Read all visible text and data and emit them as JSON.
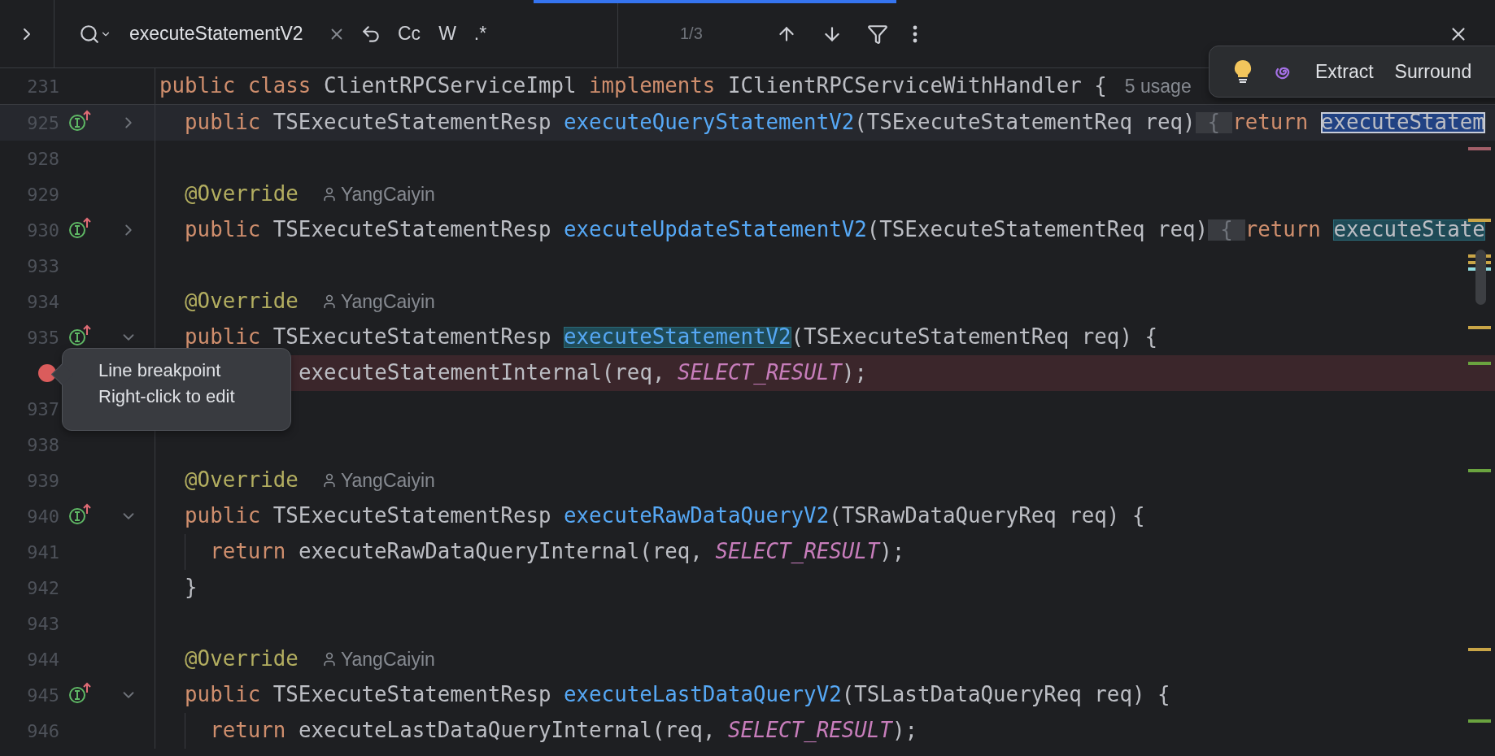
{
  "find_bar": {
    "query": "executeStatementV2",
    "options": [
      {
        "label": "Cc",
        "selected": false
      },
      {
        "label": "W",
        "selected": false
      },
      {
        "label": ".*",
        "selected": false
      }
    ],
    "match_count": "1/3"
  },
  "intention_popup": {
    "actions": [
      "Extract",
      "Surround"
    ]
  },
  "sticky_line": {
    "number": "231",
    "tokens": [
      {
        "kind": "kw",
        "text": "public "
      },
      {
        "kind": "kw",
        "text": "class "
      },
      {
        "kind": "plain",
        "text": "ClientRPCServiceImpl "
      },
      {
        "kind": "kw",
        "text": "implements "
      },
      {
        "kind": "plain",
        "text": "IClientRPCServiceWithHandler {"
      },
      {
        "kind": "usages",
        "text": "5 usage"
      }
    ]
  },
  "lines": [
    {
      "number": "925",
      "kind": "member",
      "impl": true,
      "expanded": false,
      "current": true,
      "tokens": [
        {
          "kind": "kw",
          "text": "public "
        },
        {
          "kind": "plain",
          "text": "TSExecuteStatementResp "
        },
        {
          "kind": "method",
          "text": "executeQueryStatementV2"
        },
        {
          "kind": "plain",
          "text": "(TSExecuteStatementReq req)"
        },
        {
          "kind": "brace",
          "text": "{"
        },
        {
          "kind": "kw",
          "text": "return "
        },
        {
          "kind": "match",
          "method": false,
          "selected": true,
          "text": "executeStatem"
        }
      ]
    },
    {
      "number": "928",
      "marks": [
        {
          "color": "#a35f69"
        }
      ]
    },
    {
      "number": "929",
      "kind": "member",
      "tokens": [
        {
          "kind": "annotation",
          "text": "@Override"
        },
        {
          "kind": "author",
          "text": "YangCaiyin"
        }
      ]
    },
    {
      "number": "930",
      "kind": "member",
      "impl": true,
      "expanded": false,
      "marks": [
        {
          "color": "#c9a547"
        }
      ],
      "tokens": [
        {
          "kind": "kw",
          "text": "public "
        },
        {
          "kind": "plain",
          "text": "TSExecuteStatementResp "
        },
        {
          "kind": "method",
          "text": "executeUpdateStatementV2"
        },
        {
          "kind": "plain",
          "text": "(TSExecuteStatementReq req)"
        },
        {
          "kind": "brace",
          "text": "{"
        },
        {
          "kind": "kw",
          "text": "return "
        },
        {
          "kind": "match",
          "method": false,
          "selected": false,
          "text": "executeState"
        }
      ]
    },
    {
      "number": "933",
      "marks": [
        {
          "color": "#c9a547"
        },
        {
          "color": "#c9a547"
        },
        {
          "color": "#8fd9dc"
        }
      ]
    },
    {
      "number": "934",
      "kind": "member",
      "tokens": [
        {
          "kind": "annotation",
          "text": "@Override"
        },
        {
          "kind": "author",
          "text": "YangCaiyin"
        }
      ]
    },
    {
      "number": "935",
      "kind": "member",
      "impl": true,
      "expanded": true,
      "marks": [
        {
          "color": "#c9a547"
        }
      ],
      "tokens": [
        {
          "kind": "kw",
          "text": "public "
        },
        {
          "kind": "plain",
          "text": "TSExecuteStatementResp "
        },
        {
          "kind": "match",
          "method": true,
          "selected": false,
          "text": "executeStatementV2"
        },
        {
          "kind": "plain",
          "text": "(TSExecuteStatementReq req) {"
        }
      ]
    },
    {
      "kind": "covered",
      "breakpoint": true,
      "marks": [
        {
          "color": "#6aa33f"
        }
      ],
      "tokens": [
        {
          "kind": "plain",
          "text": "executeStatementInternal(req, "
        },
        {
          "kind": "const",
          "text": "SELECT_RESULT"
        },
        {
          "kind": "plain",
          "text": ");"
        }
      ]
    },
    {
      "number": "937"
    },
    {
      "number": "938"
    },
    {
      "number": "939",
      "kind": "member",
      "marks": [
        {
          "color": "#6aa33f"
        }
      ],
      "tokens": [
        {
          "kind": "annotation",
          "text": "@Override"
        },
        {
          "kind": "author",
          "text": "YangCaiyin"
        }
      ]
    },
    {
      "number": "940",
      "kind": "member",
      "impl": true,
      "expanded": true,
      "tokens": [
        {
          "kind": "kw",
          "text": "public "
        },
        {
          "kind": "plain",
          "text": "TSExecuteStatementResp "
        },
        {
          "kind": "method",
          "text": "executeRawDataQueryV2"
        },
        {
          "kind": "plain",
          "text": "(TSRawDataQueryReq req) {"
        }
      ]
    },
    {
      "number": "941",
      "kind": "statement",
      "guide": true,
      "tokens": [
        {
          "kind": "kw",
          "text": "return "
        },
        {
          "kind": "plain",
          "text": "executeRawDataQueryInternal(req, "
        },
        {
          "kind": "const",
          "text": "SELECT_RESULT"
        },
        {
          "kind": "plain",
          "text": ");"
        }
      ]
    },
    {
      "number": "942",
      "kind": "member",
      "tokens": [
        {
          "kind": "plain",
          "text": "}"
        }
      ]
    },
    {
      "number": "943"
    },
    {
      "number": "944",
      "kind": "member",
      "marks": [
        {
          "color": "#c9a547"
        }
      ],
      "tokens": [
        {
          "kind": "annotation",
          "text": "@Override"
        },
        {
          "kind": "author",
          "text": "YangCaiyin"
        }
      ]
    },
    {
      "number": "945",
      "kind": "member",
      "impl": true,
      "expanded": true,
      "tokens": [
        {
          "kind": "kw",
          "text": "public "
        },
        {
          "kind": "plain",
          "text": "TSExecuteStatementResp "
        },
        {
          "kind": "method",
          "text": "executeLastDataQueryV2"
        },
        {
          "kind": "plain",
          "text": "(TSLastDataQueryReq req) {"
        }
      ]
    },
    {
      "number": "946",
      "kind": "statement",
      "guide": true,
      "marks": [
        {
          "color": "#6aa33f"
        }
      ],
      "tokens": [
        {
          "kind": "kw",
          "text": "return "
        },
        {
          "kind": "plain",
          "text": "executeLastDataQueryInternal(req, "
        },
        {
          "kind": "const",
          "text": "SELECT_RESULT"
        },
        {
          "kind": "plain",
          "text": ");"
        }
      ]
    }
  ],
  "tooltip": {
    "lines": [
      "Line breakpoint",
      "Right-click to edit"
    ]
  }
}
